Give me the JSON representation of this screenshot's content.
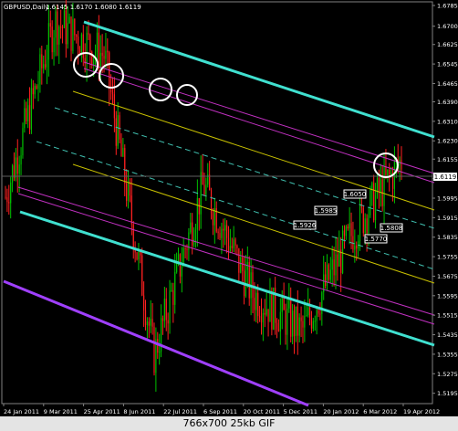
{
  "header": {
    "symbol": "GBPUSD,Daily",
    "quote": "1.6145  1.6170  1.6080  1.6119"
  },
  "caption": "766x700  25kb  GIF",
  "colors": {
    "background": "#000000",
    "up_candle": "#00c000",
    "down_candle": "#ff2020",
    "cyan_channel": "#40e0d0",
    "dashed_cyan": "#40c0b0",
    "magenta": "#c030c0",
    "violet": "#a040ff",
    "yellow": "#c8c000",
    "grid": "#808080"
  },
  "chart_data": {
    "type": "line",
    "title": "GBPUSD,Daily",
    "ylim": [
      1.516,
      1.6785
    ],
    "y_ticks": [
      "1.6785",
      "1.6700",
      "1.6625",
      "1.6545",
      "1.6465",
      "1.6390",
      "1.6310",
      "1.6230",
      "1.6155",
      "1.6075",
      "1.5995",
      "1.5915",
      "1.5835",
      "1.5755",
      "1.5675",
      "1.5595",
      "1.5515",
      "1.5435",
      "1.5355",
      "1.5275",
      "1.5195"
    ],
    "x_ticks": [
      "24 Jan 2011",
      "9 Mar 2011",
      "25 Apr 2011",
      "8 Jun 2011",
      "22 Jul 2011",
      "6 Sep 2011",
      "20 Oct 2011",
      "5 Dec 2011",
      "20 Jan 2012",
      "6 Mar 2012",
      "19 Apr 2012"
    ],
    "current_price": 1.6119,
    "series": [
      {
        "name": "",
        "x": [
          "24 Jan 2011",
          "25 Apr 2011",
          "22 Jul 2011",
          "6 Sep 2011",
          "20 Oct 2011",
          "5 Dec 2011",
          "20 Jan 2012",
          "6 Mar 2012",
          "19 Apr 2012"
        ],
        "values": [
          1.6,
          1.672,
          1.658,
          1.535,
          1.605,
          1.56,
          1.545,
          1.585,
          1.615
        ]
      }
    ],
    "price_labels": [
      "1.6050",
      "1.5985",
      "1.5926",
      "1.5808",
      "1.5770"
    ]
  }
}
